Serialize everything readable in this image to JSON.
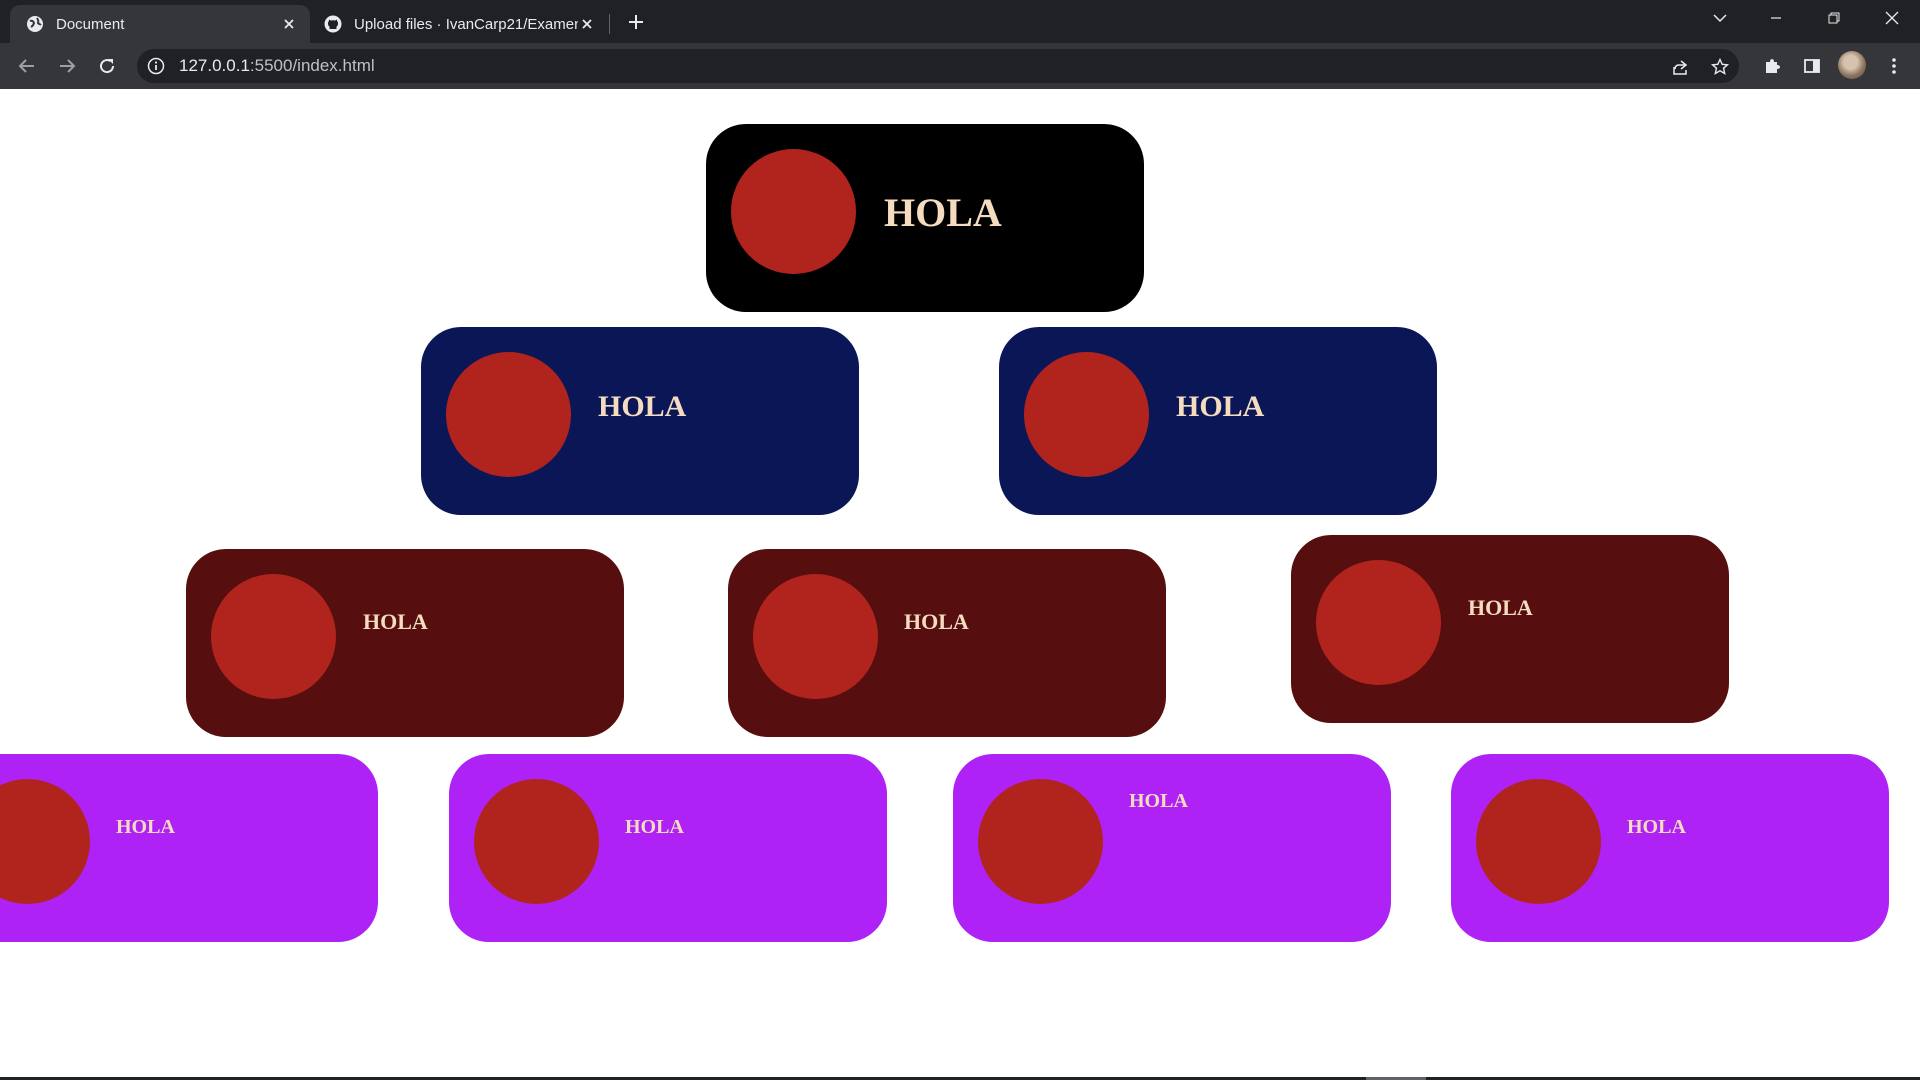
{
  "browser": {
    "tabs": [
      {
        "title": "Document",
        "active": true,
        "icon": "globe-icon"
      },
      {
        "title": "Upload files · IvanCarp21/Examen",
        "active": false,
        "icon": "github-icon"
      }
    ],
    "address": {
      "host": "127.0.0.1",
      "path": ":5500/index.html"
    }
  },
  "cards": [
    {
      "label": "HOLA",
      "color": "#000000",
      "tier": "top"
    },
    {
      "label": "HOLA",
      "color": "#0b1657",
      "tier": "second"
    },
    {
      "label": "HOLA",
      "color": "#0b1657",
      "tier": "second"
    },
    {
      "label": "HOLA",
      "color": "#560f0e",
      "tier": "third"
    },
    {
      "label": "HOLA",
      "color": "#560f0e",
      "tier": "third"
    },
    {
      "label": "HOLA",
      "color": "#560f0e",
      "tier": "third"
    },
    {
      "label": "HOLA",
      "color": "#af22f5",
      "tier": "bottom"
    },
    {
      "label": "HOLA",
      "color": "#af22f5",
      "tier": "bottom"
    },
    {
      "label": "HOLA",
      "color": "#af22f5",
      "tier": "bottom"
    },
    {
      "label": "HOLA",
      "color": "#af22f5",
      "tier": "bottom"
    }
  ],
  "colors": {
    "circle": "#b1241d",
    "label_text": "#f5dcc0"
  }
}
